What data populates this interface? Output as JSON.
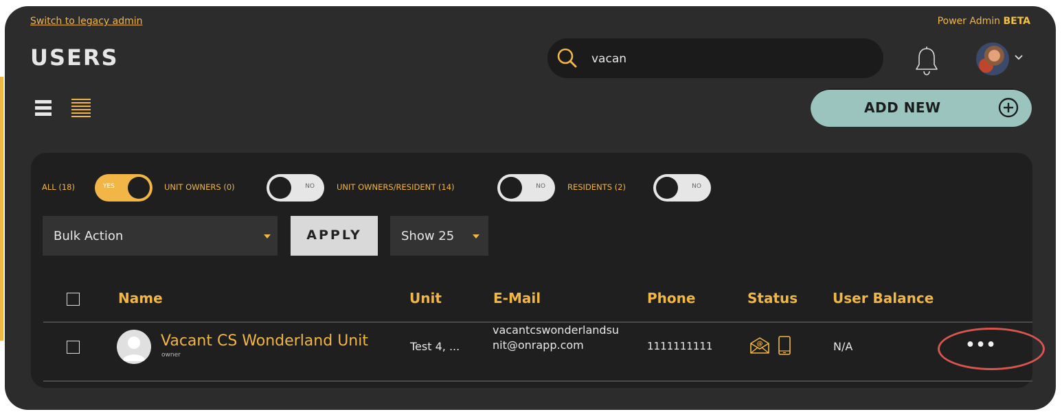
{
  "header": {
    "legacy_link": "Switch to legacy admin",
    "power_admin": "Power Admin",
    "beta": "BETA",
    "title": "USERS"
  },
  "search": {
    "value": "vacan",
    "placeholder": "",
    "icon": "search-icon"
  },
  "add_new": {
    "label": "ADD NEW",
    "icon": "plus-circle-icon"
  },
  "filters": [
    {
      "label": "ALL (18)",
      "state": "YES",
      "on": true
    },
    {
      "label": "UNIT OWNERS (0)",
      "state": "NO",
      "on": false
    },
    {
      "label": "UNIT OWNERS/RESIDENT (14)",
      "state": "NO",
      "on": false
    },
    {
      "label": "RESIDENTS (2)",
      "state": "NO",
      "on": false
    }
  ],
  "bulk_action": {
    "label": "Bulk Action"
  },
  "apply": {
    "label": "APPLY"
  },
  "show": {
    "label": "Show 25"
  },
  "table": {
    "columns": [
      "Name",
      "Unit",
      "E-Mail",
      "Phone",
      "Status",
      "User Balance"
    ],
    "rows": [
      {
        "name": "Vacant CS Wonderland Unit",
        "role": "owner",
        "unit": "Test 4, ...",
        "email": "vacantcswonderlandsunit@onrapp.com",
        "phone": "1111111111",
        "balance": "N/A",
        "more": "•••"
      }
    ]
  },
  "colors": {
    "accent": "#f2b646",
    "background": "#2c2c2c",
    "panel": "#1f1f1f",
    "add_button": "#9cc4bf",
    "highlight": "#d9564f"
  }
}
